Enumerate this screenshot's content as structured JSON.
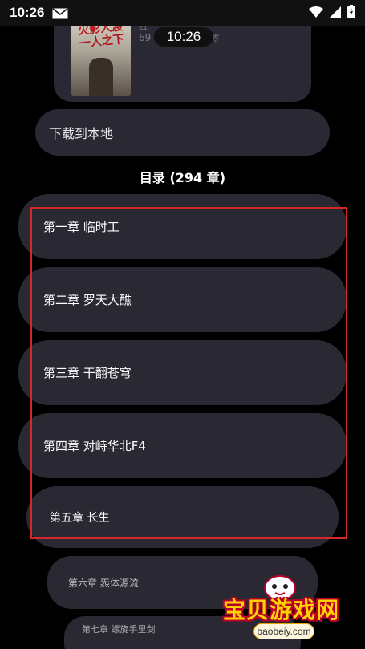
{
  "status_bar": {
    "time": "10:26",
    "icons": [
      "mail-icon",
      "wifi-icon",
      "signal-icon",
      "battery-icon"
    ]
  },
  "time_pill": "10:26",
  "book": {
    "cover_title": "火影人渡 一人之下",
    "meta_line_1": "红",
    "meta_line_2": "69",
    "meta_tag": "签"
  },
  "download_label": "下载到本地",
  "toc_title": "目录 (294 章)",
  "chapters": [
    "第一章 临时工",
    "第二章 罗天大醮",
    "第三章 干翻苍穹",
    "第四章 对峙华北F4",
    "第五章 长生",
    "第六章 炁体源流",
    "第七章 螺旋手里剑"
  ],
  "watermark": {
    "text": "宝贝游戏网",
    "url": "baobeiy.com"
  },
  "colors": {
    "background": "#000000",
    "card": "#2a2833",
    "highlight_border": "#d42828",
    "watermark_text": "#ffd200"
  }
}
